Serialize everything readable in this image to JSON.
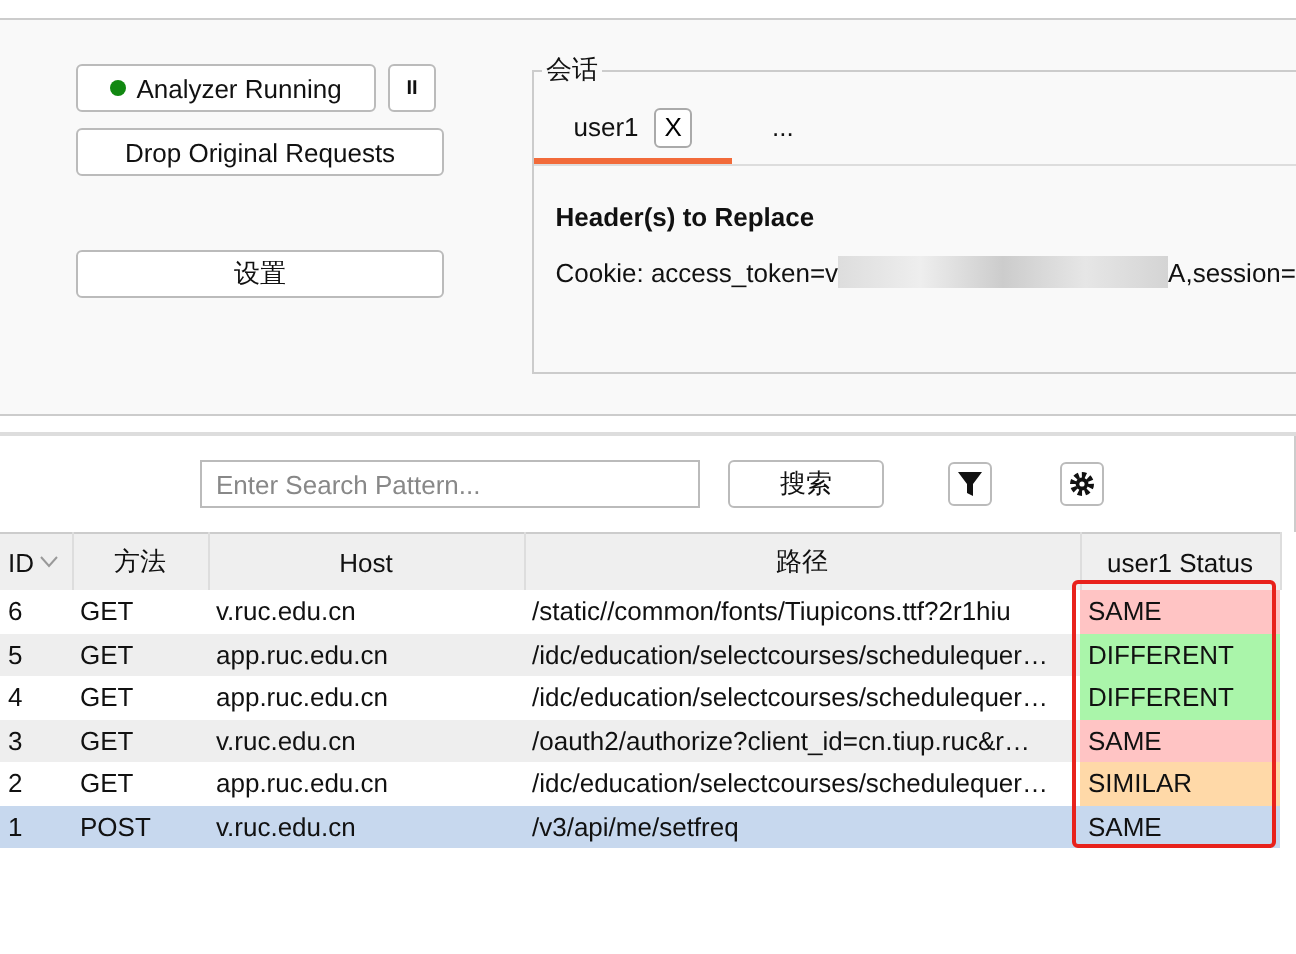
{
  "controls": {
    "analyzer_button": "Analyzer Running",
    "running": true,
    "pause_button": "II",
    "drop_button": "Drop Original Requests",
    "settings_button": "设置"
  },
  "session": {
    "legend": "会话",
    "tabs": [
      {
        "label": "user1",
        "close": "X",
        "selected": true
      },
      {
        "label": "...",
        "selected": false
      }
    ],
    "header_title": "Header(s) to Replace",
    "cookie_prefix": "Cookie: access_token=v",
    "cookie_suffix": "A,session="
  },
  "search": {
    "placeholder": "Enter Search Pattern...",
    "button": "搜索"
  },
  "table": {
    "columns": [
      "ID",
      "方法",
      "Host",
      "路径",
      "user1 Status"
    ],
    "rows": [
      {
        "id": "6",
        "method": "GET",
        "host": "v.ruc.edu.cn",
        "path": "/static//common/fonts/Tiupicons.ttf?2r1hiu",
        "status": "SAME",
        "kind": "same",
        "selected": false
      },
      {
        "id": "5",
        "method": "GET",
        "host": "app.ruc.edu.cn",
        "path": "/idc/education/selectcourses/schedulequer…",
        "status": "DIFFERENT",
        "kind": "different",
        "selected": false
      },
      {
        "id": "4",
        "method": "GET",
        "host": "app.ruc.edu.cn",
        "path": "/idc/education/selectcourses/schedulequer…",
        "status": "DIFFERENT",
        "kind": "different",
        "selected": false
      },
      {
        "id": "3",
        "method": "GET",
        "host": "v.ruc.edu.cn",
        "path": "/oauth2/authorize?client_id=cn.tiup.ruc&r…",
        "status": "SAME",
        "kind": "same",
        "selected": false
      },
      {
        "id": "2",
        "method": "GET",
        "host": "app.ruc.edu.cn",
        "path": "/idc/education/selectcourses/schedulequer…",
        "status": "SIMILAR",
        "kind": "similar",
        "selected": false
      },
      {
        "id": "1",
        "method": "POST",
        "host": "v.ruc.edu.cn",
        "path": "/v3/api/me/setfreq",
        "status": "SAME",
        "kind": "same",
        "selected": true
      }
    ]
  }
}
